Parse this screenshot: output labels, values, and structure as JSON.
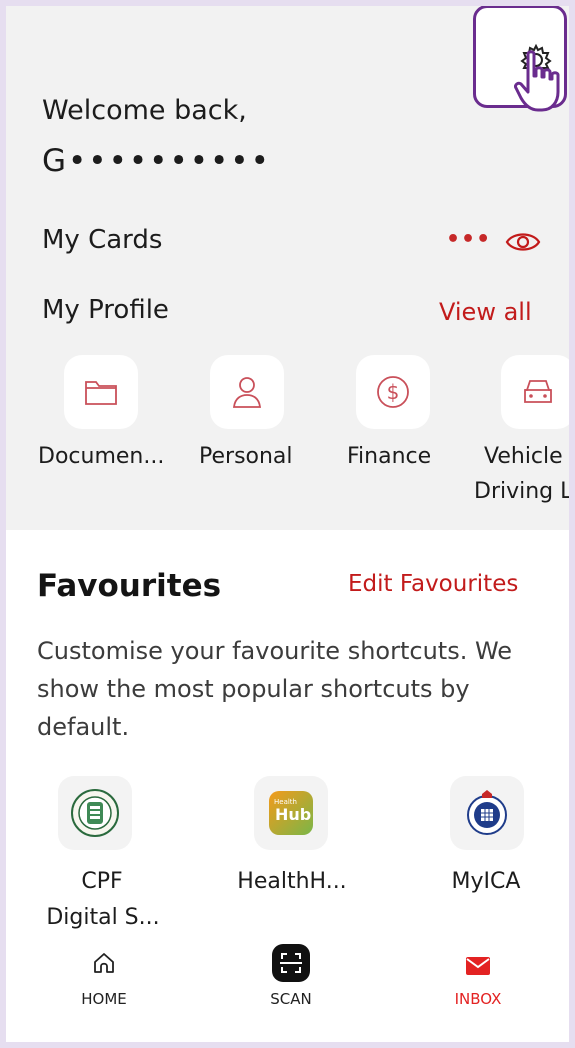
{
  "header": {
    "welcome": "Welcome back,",
    "masked_name": "G••••••••••"
  },
  "cards": {
    "title": "My Cards",
    "more_glyph": "•••",
    "visibility_icon": "eye-icon"
  },
  "profile": {
    "title": "My Profile",
    "view_all": "View all",
    "items": [
      {
        "label": "Documen...",
        "icon": "folder-icon"
      },
      {
        "label": "Personal",
        "icon": "person-icon"
      },
      {
        "label": "Finance",
        "icon": "dollar-icon"
      },
      {
        "label": "Vehicle",
        "label2": "Driving Li",
        "icon": "car-icon"
      }
    ]
  },
  "favourites": {
    "title": "Favourites",
    "edit": "Edit Favourites",
    "description": "Customise your favourite shortcuts. We show the most popular shortcuts by default.",
    "items": [
      {
        "label": "CPF",
        "label2": "Digital S...",
        "icon": "cpf-logo-icon"
      },
      {
        "label": "HealthH...",
        "icon": "healthhub-logo-icon",
        "logo_text1": "Health",
        "logo_text2": "Hub"
      },
      {
        "label": "MyICA",
        "icon": "ica-logo-icon"
      }
    ]
  },
  "nav": {
    "home": "HOME",
    "scan": "SCAN",
    "inbox": "INBOX"
  },
  "colors": {
    "accent": "#c21b1b",
    "highlight": "#6a2c8e",
    "top_bg": "#f2f2f2"
  }
}
